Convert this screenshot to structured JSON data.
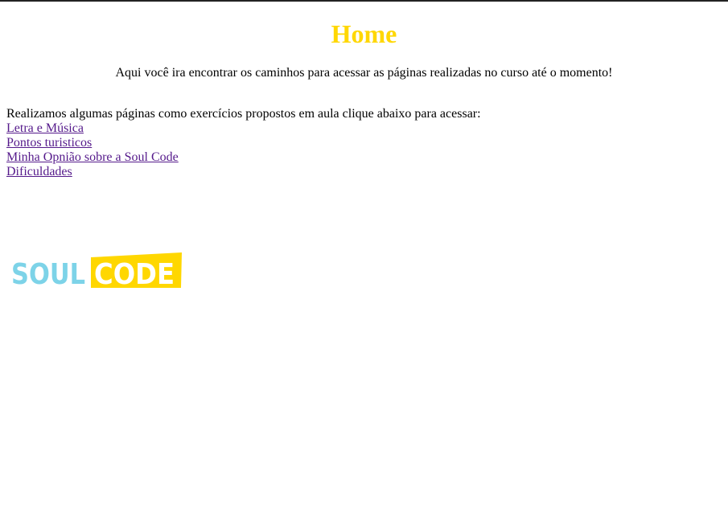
{
  "page": {
    "title": "Home",
    "subtitle": "Aqui você ira encontrar os caminhos para acessar as páginas realizadas no curso até o momento!",
    "intro": "Realizamos algumas páginas como exercícios propostos em aula clique abaixo para acessar:"
  },
  "links": [
    {
      "label": "Letra e Música"
    },
    {
      "label": "Pontos turisticos"
    },
    {
      "label": "Minha Opnião sobre a Soul Code"
    },
    {
      "label": "Dificuldades"
    }
  ],
  "logo": {
    "text_soul": "SOUL",
    "text_code": "CODE",
    "color_soul": "#7dd3e8",
    "color_code_bg": "#ffd700"
  },
  "colors": {
    "title": "#ffd700",
    "link_visited": "#551a8b",
    "text": "#000000"
  }
}
